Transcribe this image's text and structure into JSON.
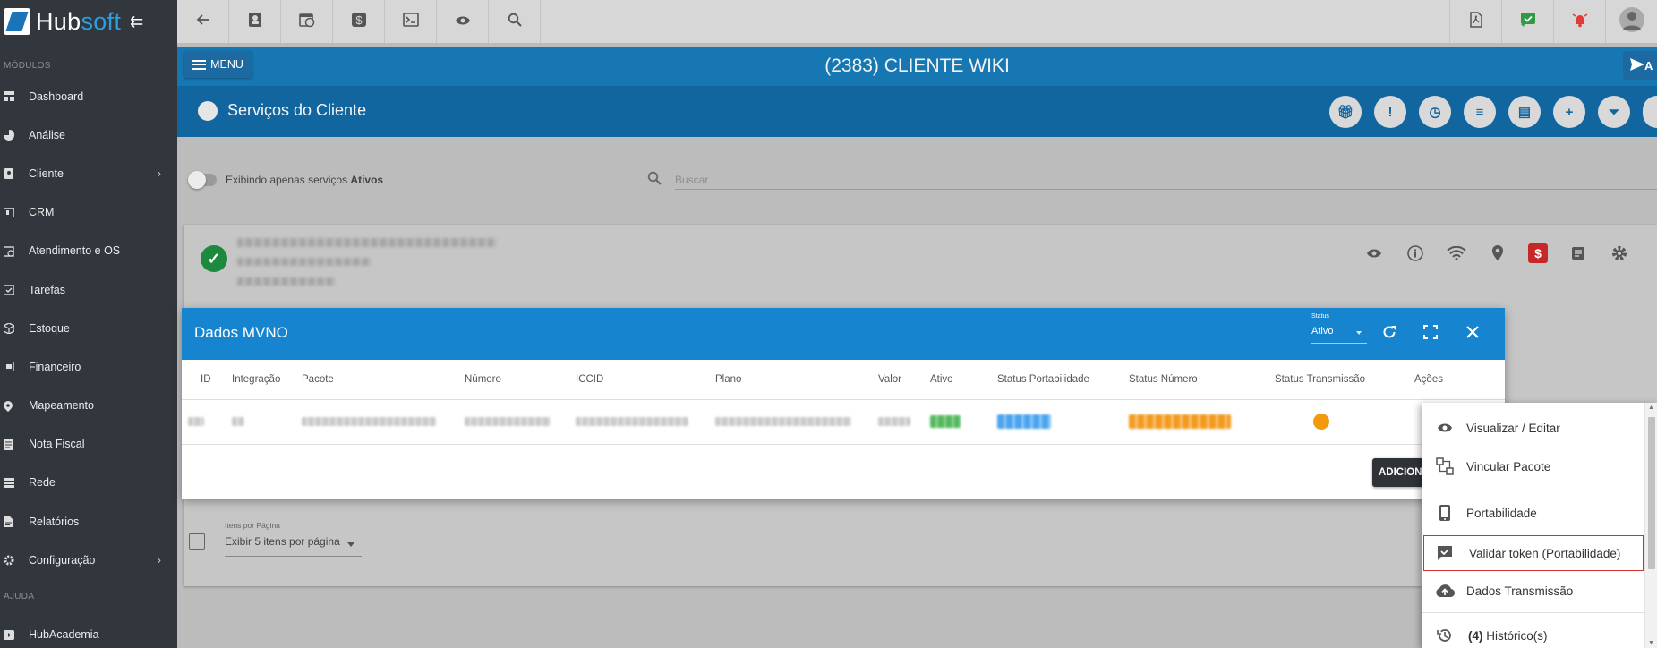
{
  "app": {
    "brand_hub": "Hub",
    "brand_soft": "soft",
    "collapse_glyph": "⇇"
  },
  "sidebar": {
    "section_modules": "MÓDULOS",
    "section_help": "AJUDA",
    "items": [
      {
        "label": "Dashboard",
        "icon": "dashboard-icon"
      },
      {
        "label": "Análise",
        "icon": "pie-chart-icon"
      },
      {
        "label": "Cliente",
        "icon": "contact-card-icon",
        "has_children": true
      },
      {
        "label": "CRM",
        "icon": "crm-icon"
      },
      {
        "label": "Atendimento e OS",
        "icon": "calendar-clock-icon"
      },
      {
        "label": "Tarefas",
        "icon": "tasks-icon"
      },
      {
        "label": "Estoque",
        "icon": "box-icon"
      },
      {
        "label": "Financeiro",
        "icon": "finance-icon"
      },
      {
        "label": "Mapeamento",
        "icon": "map-pin-icon"
      },
      {
        "label": "Nota Fiscal",
        "icon": "invoice-icon"
      },
      {
        "label": "Rede",
        "icon": "network-icon"
      },
      {
        "label": "Relatórios",
        "icon": "report-icon"
      },
      {
        "label": "Configuração",
        "icon": "gear-icon",
        "has_children": true
      }
    ],
    "help_items": [
      {
        "label": "HubAcademia",
        "icon": "play-icon"
      }
    ]
  },
  "header": {
    "menu_label": "MENU",
    "client_title": "(2383) CLIENTE WIKI",
    "send_glyph": "A"
  },
  "services": {
    "title": "Serviços do Cliente",
    "toggle_text": "Exibindo apenas serviços ",
    "toggle_bold": "Ativos",
    "search_placeholder": "Buscar",
    "items_per_page_label": "Itens por Página",
    "items_per_page_value": "Exibir 5 itens por página"
  },
  "modal": {
    "title": "Dados MVNO",
    "status_label": "Status",
    "status_value": "Ativo",
    "columns": [
      "ID",
      "Integração",
      "Pacote",
      "Número",
      "ICCID",
      "Plano",
      "Valor",
      "Ativo",
      "Status Portabilidade",
      "Status Número",
      "Status Transmissão",
      "Ações"
    ],
    "add_button": "ADICIONAR",
    "transmission_status_color": "#f39a0c"
  },
  "actions_menu": {
    "items": [
      {
        "label": "Visualizar / Editar",
        "icon": "eye-icon"
      },
      {
        "label": "Vincular Pacote",
        "icon": "link-package-icon"
      },
      {
        "label": "Portabilidade",
        "icon": "phone-icon"
      },
      {
        "label": "Validar token (Portabilidade)",
        "icon": "comment-check-icon"
      },
      {
        "label": "Dados Transmissão",
        "icon": "cloud-upload-icon"
      },
      {
        "label_count": "(4)",
        "label": " Histórico(s)",
        "icon": "history-icon"
      }
    ]
  },
  "colors": {
    "sidebar_bg": "#32373e",
    "header_blue": "#1677b3",
    "modal_blue": "#1784d0",
    "highlight_red": "#d32f2f",
    "success_green": "#1b8a3f"
  }
}
